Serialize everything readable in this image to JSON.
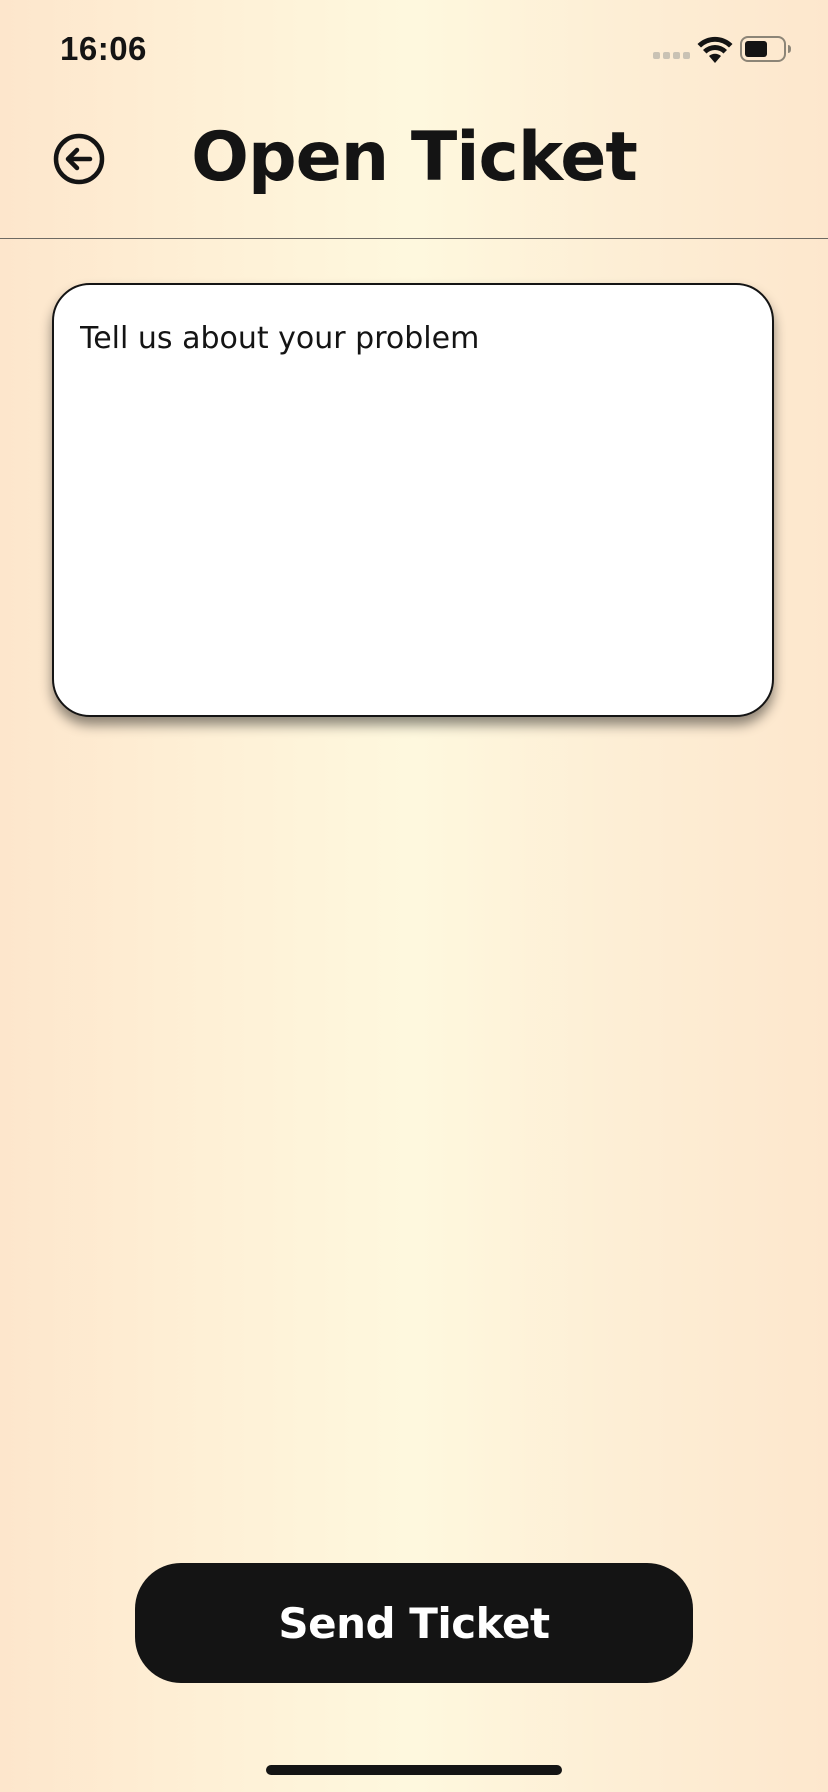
{
  "status_bar": {
    "time": "16:06",
    "icons": [
      "cellular-signal-icon",
      "wifi-icon",
      "battery-icon"
    ]
  },
  "header": {
    "title": "Open Ticket",
    "back_icon": "arrow-left-circle-icon"
  },
  "ticket_form": {
    "placeholder": "Tell us about your problem",
    "value": ""
  },
  "actions": {
    "send_label": "Send Ticket"
  },
  "colors": {
    "background_start": "#fde6cc",
    "background_mid": "#fef8de",
    "text": "#141414",
    "button_bg": "#141414",
    "button_text": "#ffffff",
    "input_bg": "#ffffff"
  }
}
